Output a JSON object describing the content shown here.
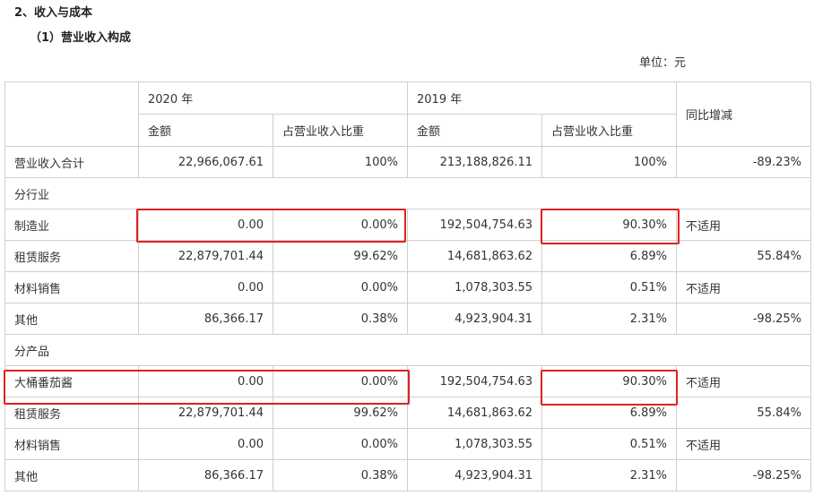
{
  "headings": {
    "section": "2、收入与成本",
    "subsection": "（1）营业收入构成",
    "unit": "单位：元"
  },
  "table": {
    "header": {
      "year_2020": "2020 年",
      "year_2019": "2019 年",
      "yoy": "同比增减",
      "amount": "金额",
      "ratio": "占营业收入比重"
    },
    "total": {
      "label": "营业收入合计",
      "amt2020": "22,966,067.61",
      "pct2020": "100%",
      "amt2019": "213,188,826.11",
      "pct2019": "100%",
      "yoy": "-89.23%"
    },
    "section_industry": "分行业",
    "industry_rows": [
      {
        "label": "制造业",
        "amt2020": "0.00",
        "pct2020": "0.00%",
        "amt2019": "192,504,754.63",
        "pct2019": "90.30%",
        "yoy": "不适用"
      },
      {
        "label": "租赁服务",
        "amt2020": "22,879,701.44",
        "pct2020": "99.62%",
        "amt2019": "14,681,863.62",
        "pct2019": "6.89%",
        "yoy": "55.84%"
      },
      {
        "label": "材料销售",
        "amt2020": "0.00",
        "pct2020": "0.00%",
        "amt2019": "1,078,303.55",
        "pct2019": "0.51%",
        "yoy": "不适用"
      },
      {
        "label": "其他",
        "amt2020": "86,366.17",
        "pct2020": "0.38%",
        "amt2019": "4,923,904.31",
        "pct2019": "2.31%",
        "yoy": "-98.25%"
      }
    ],
    "section_product": "分产品",
    "product_rows": [
      {
        "label": "大桶番茄酱",
        "amt2020": "0.00",
        "pct2020": "0.00%",
        "amt2019": "192,504,754.63",
        "pct2019": "90.30%",
        "yoy": "不适用"
      },
      {
        "label": "租赁服务",
        "amt2020": "22,879,701.44",
        "pct2020": "99.62%",
        "amt2019": "14,681,863.62",
        "pct2019": "6.89%",
        "yoy": "55.84%"
      },
      {
        "label": "材料销售",
        "amt2020": "0.00",
        "pct2020": "0.00%",
        "amt2019": "1,078,303.55",
        "pct2019": "0.51%",
        "yoy": "不适用"
      },
      {
        "label": "其他",
        "amt2020": "86,366.17",
        "pct2020": "0.38%",
        "amt2019": "4,923,904.31",
        "pct2019": "2.31%",
        "yoy": "-98.25%"
      }
    ]
  },
  "highlight_color": "#e02020"
}
